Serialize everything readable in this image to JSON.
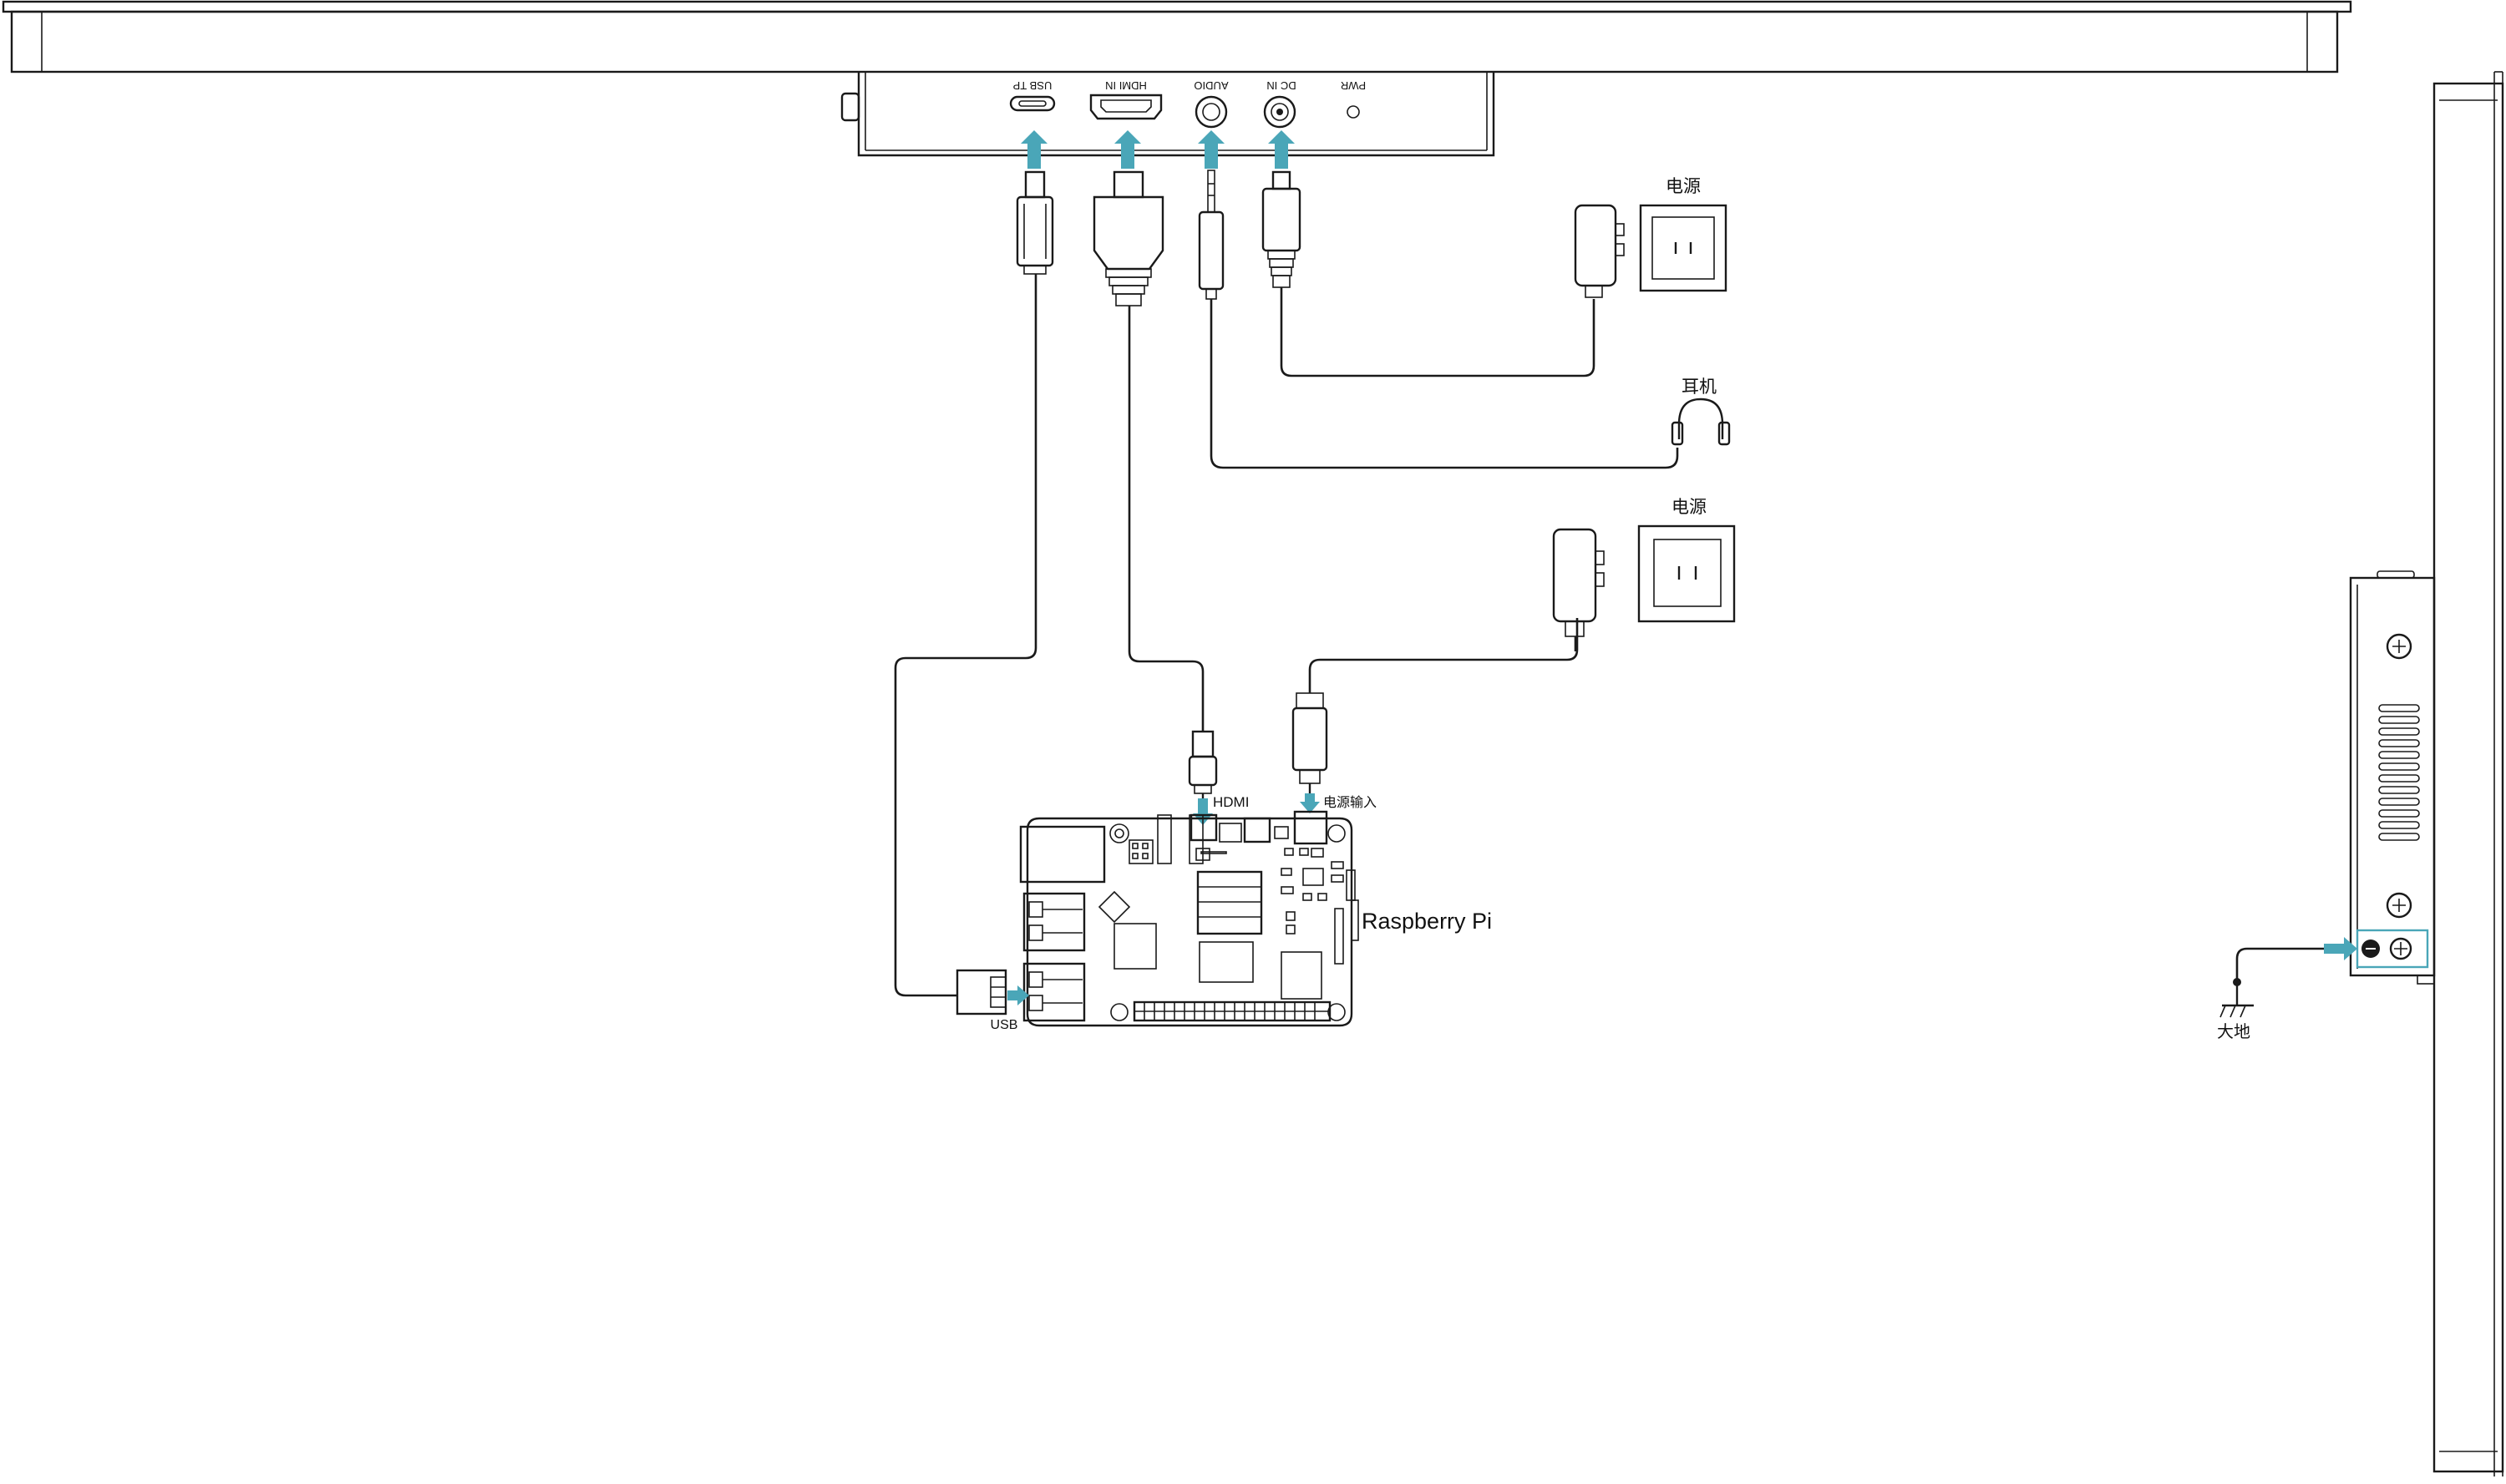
{
  "colors": {
    "accent": "#4aa6b8",
    "line": "#1a1a1a",
    "background": "#ffffff"
  },
  "ports": {
    "usb_tp": "USB TP",
    "hdmi_in": "HDMI IN",
    "audio": "AUDIO",
    "dc_in": "DC IN",
    "pwr": "PWR"
  },
  "labels": {
    "power_1": "电源",
    "headphones": "耳机",
    "power_2": "电源",
    "pi_hdmi": "HDMI",
    "pi_power_input": "电源输入",
    "board_name": "Raspberry Pi",
    "pi_usb": "USB",
    "earth_ground": "大地"
  },
  "icons": {
    "outlet_1": "wall-outlet-icon",
    "outlet_2": "wall-outlet-icon",
    "adapter_1": "power-adapter-icon",
    "adapter_2": "power-adapter-icon",
    "headphones": "headphones-icon",
    "ground": "earth-ground-icon",
    "ground_screw": "ground-screw-icon"
  }
}
